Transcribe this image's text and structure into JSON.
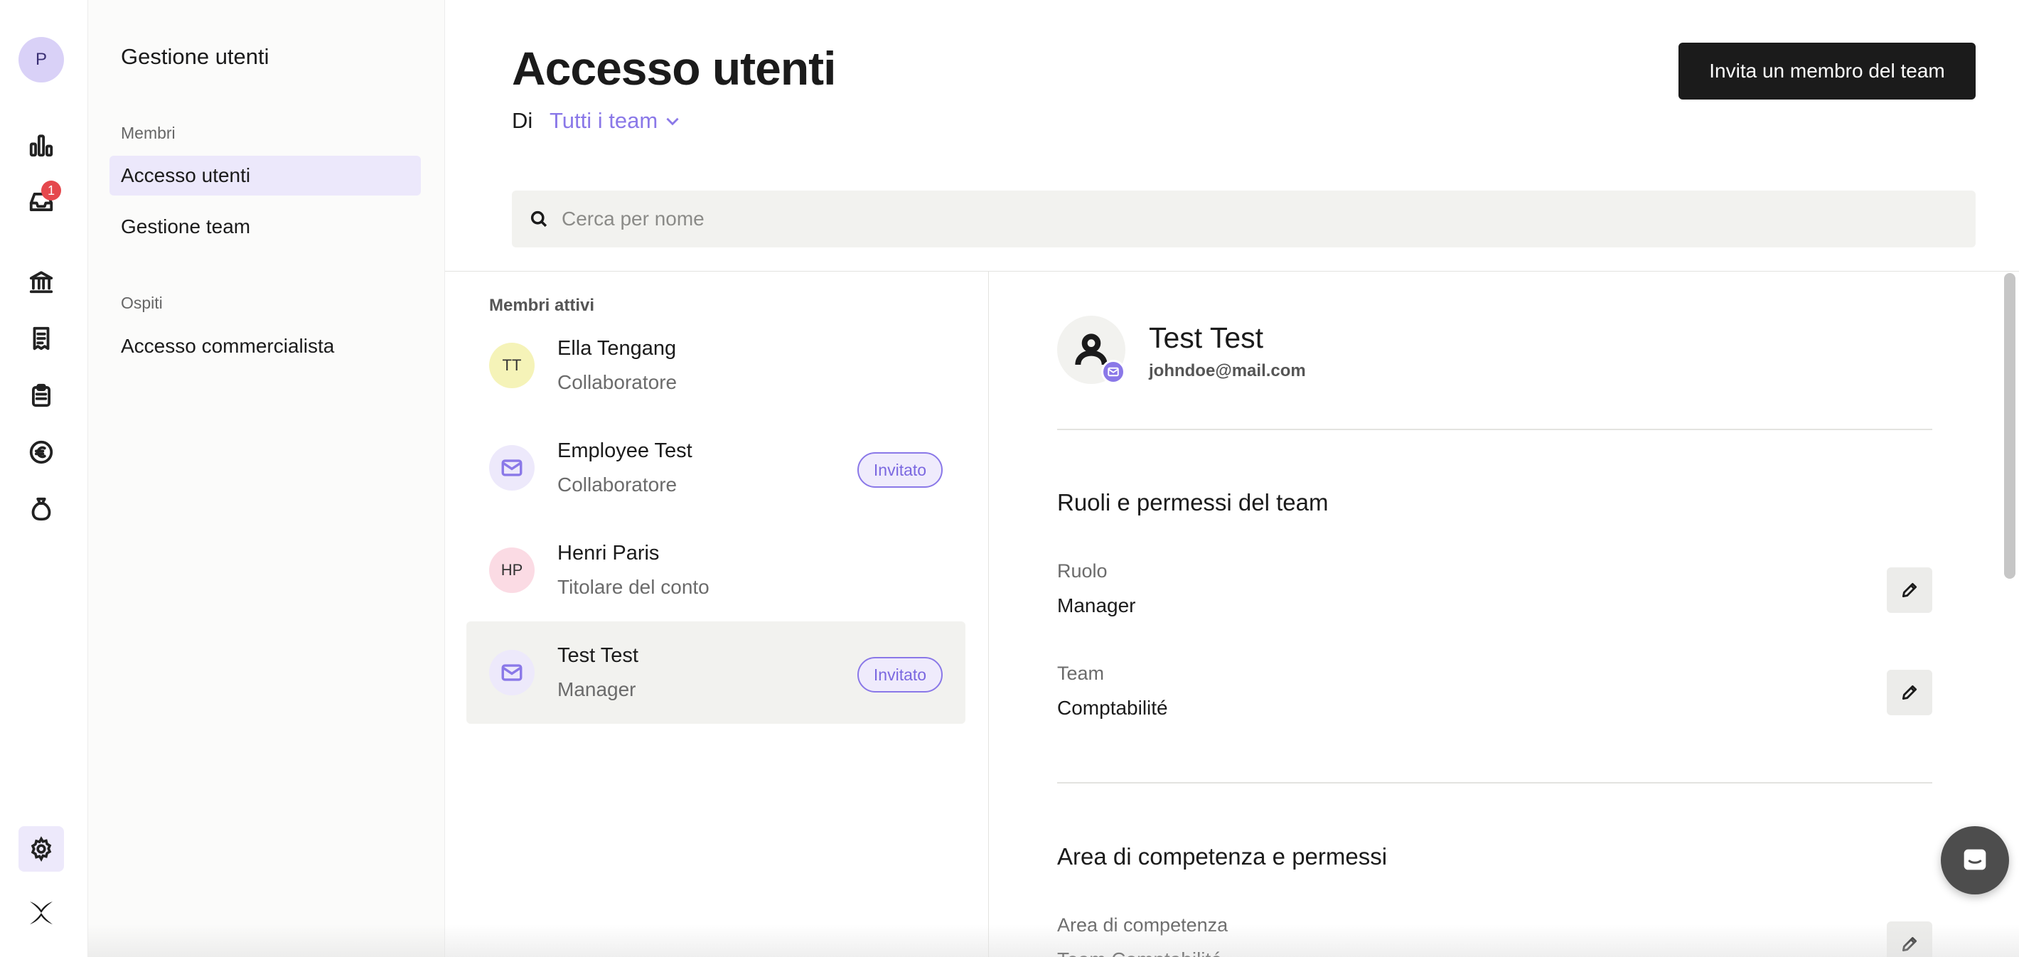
{
  "rail": {
    "avatar_initial": "P",
    "inbox_badge": "1",
    "icons": [
      "chart-bar-icon",
      "inbox-icon",
      "bank-icon",
      "receipt-icon",
      "clipboard-icon",
      "euro-coin-icon",
      "money-bag-icon",
      "gear-icon",
      "brand-logo-icon"
    ]
  },
  "sidebar": {
    "title": "Gestione utenti",
    "section_members": "Membri",
    "item_user_access": "Accesso utenti",
    "item_team_management": "Gestione team",
    "section_guests": "Ospiti",
    "item_accountant_access": "Accesso commercialista"
  },
  "header": {
    "title": "Accesso utenti",
    "by_label": "Di",
    "team_filter": "Tutti i team",
    "invite_button": "Invita un membro del team"
  },
  "search": {
    "placeholder": "Cerca per nome"
  },
  "members": {
    "header": "Membri attivi",
    "items": [
      {
        "name": "Ella Tengang",
        "role": "Collaboratore",
        "initials": "TT",
        "avatar_color": "#f5f3b8",
        "status": ""
      },
      {
        "name": "Employee Test",
        "role": "Collaboratore",
        "initials": "",
        "avatar_color": "#ede9fb",
        "status": "Invitato"
      },
      {
        "name": "Henri Paris",
        "role": "Titolare del conto",
        "initials": "HP",
        "avatar_color": "#fbdbe4",
        "status": ""
      },
      {
        "name": "Test Test",
        "role": "Manager",
        "initials": "",
        "avatar_color": "#ede9fb",
        "status": "Invitato"
      }
    ]
  },
  "detail": {
    "name": "Test Test",
    "email": "johndoe@mail.com",
    "section_roles": "Ruoli e permessi del team",
    "role_label": "Ruolo",
    "role_value": "Manager",
    "team_label": "Team",
    "team_value": "Comptabilité",
    "section_area": "Area di competenza e permessi",
    "area_label": "Area di competenza",
    "area_value": "Team Comptabilité"
  },
  "colors": {
    "accent": "#8a78e8",
    "primary_button": "#1b1b1b",
    "badge": "#e5484d"
  }
}
